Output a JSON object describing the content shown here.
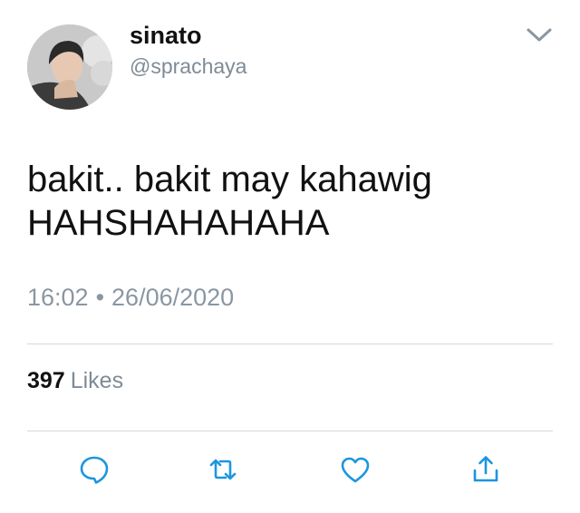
{
  "user": {
    "display_name": "sinato",
    "handle": "@sprachaya"
  },
  "tweet": {
    "text_lines": [
      "bakit.. bakit may kahawig",
      "HAHSHAHAHAHA"
    ],
    "time": "16:02",
    "separator": "•",
    "date": "26/06/2020"
  },
  "engagement": {
    "likes_count": "397",
    "likes_label": "Likes"
  },
  "icons": {
    "menu": "chevron-down-icon",
    "reply": "reply-icon",
    "retweet": "retweet-icon",
    "like": "heart-icon",
    "share": "share-icon"
  },
  "colors": {
    "background": "#ffffff",
    "primary_text": "#111111",
    "secondary_text": "#7e8b96",
    "icon_blue": "#1c95e0",
    "divider": "#d3d9de"
  }
}
